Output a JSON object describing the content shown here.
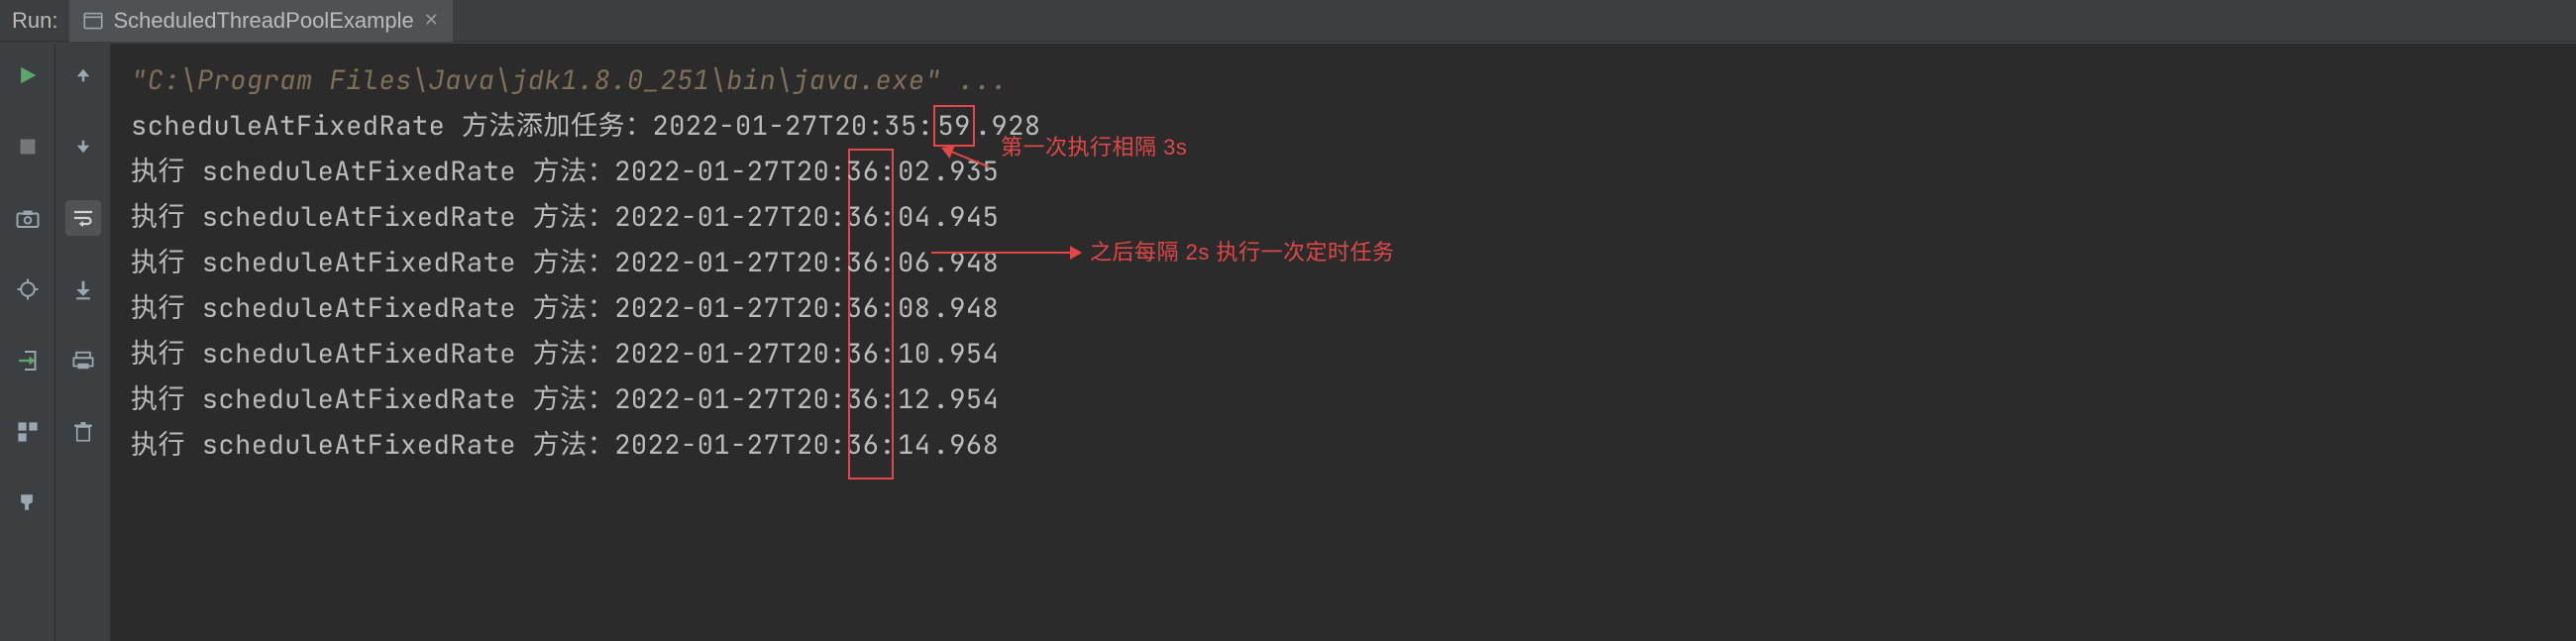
{
  "toolwindow": {
    "label": "Run:",
    "tab": {
      "name": "ScheduledThreadPoolExample"
    }
  },
  "left_toolbar": {
    "run_icon": "run-icon",
    "stop_icon": "stop-icon",
    "camera_icon": "camera-icon",
    "debug_icon": "debug-icon",
    "exit_icon": "exit-icon",
    "layout_icon": "layout-icon",
    "pin_icon": "pin-icon"
  },
  "mid_toolbar": {
    "up_icon": "arrow-up-icon",
    "down_icon": "arrow-down-icon",
    "wrap_icon": "soft-wrap-icon",
    "scroll_icon": "scroll-to-end-icon",
    "print_icon": "print-icon",
    "trash_icon": "trash-icon"
  },
  "console": {
    "cmd": "\"C:\\Program Files\\Java\\jdk1.8.0_251\\bin\\java.exe\" ...",
    "lines": [
      {
        "prefix": "scheduleAtFixedRate 方法添加任务：2022-01-27T20:35:",
        "sec": "59",
        "suffix": ".928"
      },
      {
        "prefix": "执行 scheduleAtFixedRate 方法：2022-01-27T20:36:",
        "sec": "02",
        "suffix": ".935"
      },
      {
        "prefix": "执行 scheduleAtFixedRate 方法：2022-01-27T20:36:",
        "sec": "04",
        "suffix": ".945"
      },
      {
        "prefix": "执行 scheduleAtFixedRate 方法：2022-01-27T20:36:",
        "sec": "06",
        "suffix": ".948"
      },
      {
        "prefix": "执行 scheduleAtFixedRate 方法：2022-01-27T20:36:",
        "sec": "08",
        "suffix": ".948"
      },
      {
        "prefix": "执行 scheduleAtFixedRate 方法：2022-01-27T20:36:",
        "sec": "10",
        "suffix": ".954"
      },
      {
        "prefix": "执行 scheduleAtFixedRate 方法：2022-01-27T20:36:",
        "sec": "12",
        "suffix": ".954"
      },
      {
        "prefix": "执行 scheduleAtFixedRate 方法：2022-01-27T20:36:",
        "sec": "14",
        "suffix": ".968"
      }
    ]
  },
  "annotations": {
    "first_exec": "第一次执行相隔 3s",
    "interval": "之后每隔 2s 执行一次定时任务"
  }
}
